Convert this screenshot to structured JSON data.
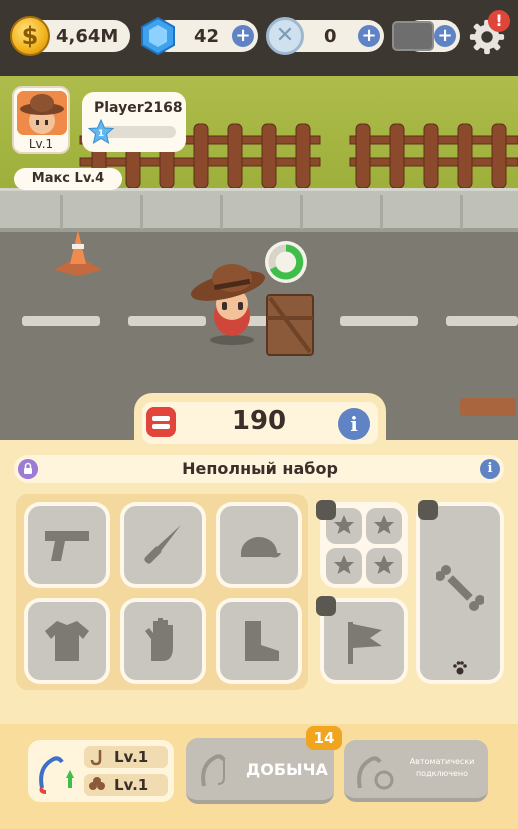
{
  "resources": {
    "coins": "4,64M",
    "gems": "42",
    "tokens": "0",
    "coin_symbol": "$"
  },
  "player": {
    "name": "Player2168",
    "avatar_level": "Lv.1",
    "star_level": "1",
    "max_level": "Макс Lv.4"
  },
  "gear": {
    "count": "190",
    "set_title": "Неполный набор",
    "info_symbol": "i",
    "slots": [
      "pistol-icon",
      "knife-icon",
      "cap-icon",
      "shirt-icon",
      "glove-icon",
      "boot-icon"
    ]
  },
  "bottom": {
    "rod_level_1": "Lv.1",
    "rod_level_2": "Lv.1",
    "loot_label": "ДОБЫЧА",
    "loot_badge": "14",
    "auto_label": "Автоматически подключено"
  },
  "colors": {
    "accent_blue": "#5f83c4",
    "panel": "#fbe8b8",
    "alert_red": "#e0453a",
    "badge_orange": "#f1a51e"
  }
}
